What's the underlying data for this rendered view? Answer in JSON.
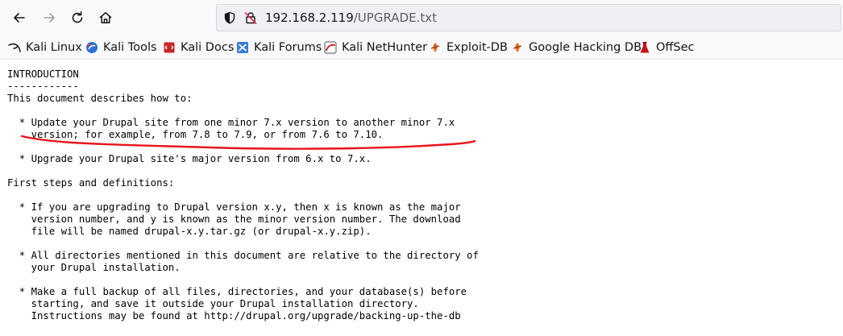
{
  "toolbar": {
    "back_icon": "arrow-left-icon",
    "forward_icon": "arrow-right-icon",
    "reload_icon": "reload-icon",
    "home_icon": "home-icon"
  },
  "urlbar": {
    "host": "192.168.2.119",
    "path": "/UPGRADE.txt",
    "security_icon": "shield-icon",
    "insecure_icon": "crossed-lock-icon"
  },
  "bookmarks": [
    {
      "label": "Kali Linux",
      "icon": "kali-dragon-icon"
    },
    {
      "label": "Kali Tools",
      "icon": "kali-tools-icon"
    },
    {
      "label": "Kali Docs",
      "icon": "kali-docs-icon"
    },
    {
      "label": "Kali Forums",
      "icon": "kali-forums-icon"
    },
    {
      "label": "Kali NetHunter",
      "icon": "nethunter-icon"
    },
    {
      "label": "Exploit-DB",
      "icon": "exploit-db-icon"
    },
    {
      "label": "Google Hacking DB",
      "icon": "ghdb-icon"
    },
    {
      "label": "OffSec",
      "icon": "offsec-icon"
    }
  ],
  "annotation": {
    "color": "#e8141b"
  },
  "document": {
    "lines": [
      "INTRODUCTION",
      "------------",
      "This document describes how to:",
      "",
      "  * Update your Drupal site from one minor 7.x version to another minor 7.x",
      "    version; for example, from 7.8 to 7.9, or from 7.6 to 7.10.",
      "",
      "  * Upgrade your Drupal site's major version from 6.x to 7.x.",
      "",
      "First steps and definitions:",
      "",
      "  * If you are upgrading to Drupal version x.y, then x is known as the major",
      "    version number, and y is known as the minor version number. The download",
      "    file will be named drupal-x.y.tar.gz (or drupal-x.y.zip).",
      "",
      "  * All directories mentioned in this document are relative to the directory of",
      "    your Drupal installation.",
      "",
      "  * Make a full backup of all files, directories, and your database(s) before",
      "    starting, and save it outside your Drupal installation directory.",
      "    Instructions may be found at http://drupal.org/upgrade/backing-up-the-db"
    ]
  }
}
